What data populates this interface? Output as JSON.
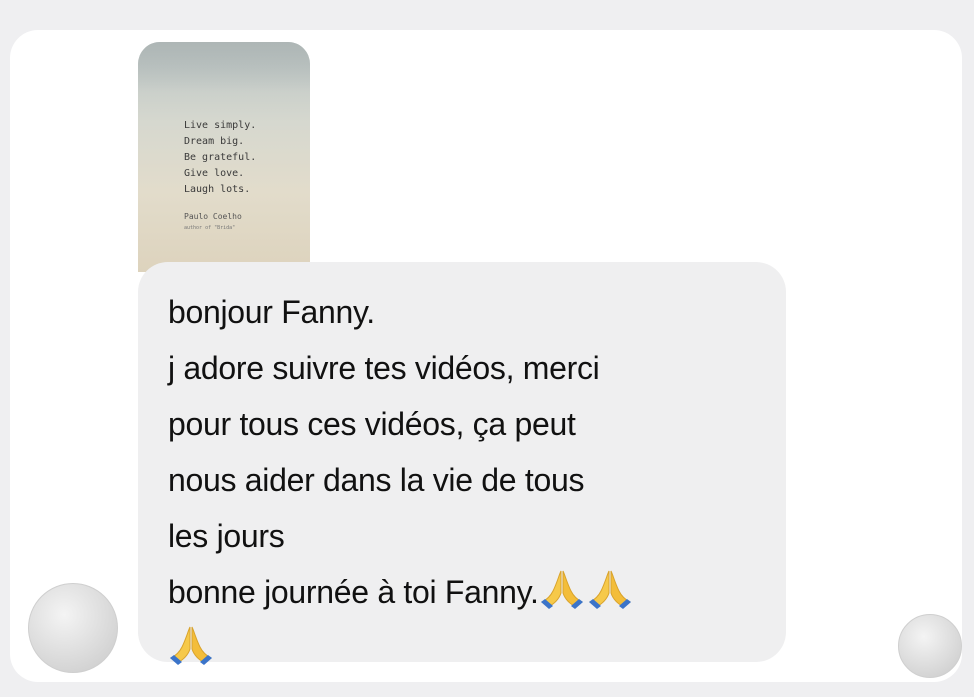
{
  "story": {
    "quote_lines": [
      "Live simply.",
      "Dream big.",
      "Be grateful.",
      "Give love.",
      "Laugh lots."
    ],
    "author": "Paulo Coelho",
    "author_sub": "author of \"Brida\""
  },
  "message": {
    "lines": [
      "bonjour Fanny.",
      "j adore suivre tes vidéos, merci",
      "pour tous ces vidéos, ça peut",
      "nous aider dans la vie de tous",
      "les jours",
      "bonne journée à toi Fanny."
    ],
    "emoji": "folded-hands-icon"
  }
}
